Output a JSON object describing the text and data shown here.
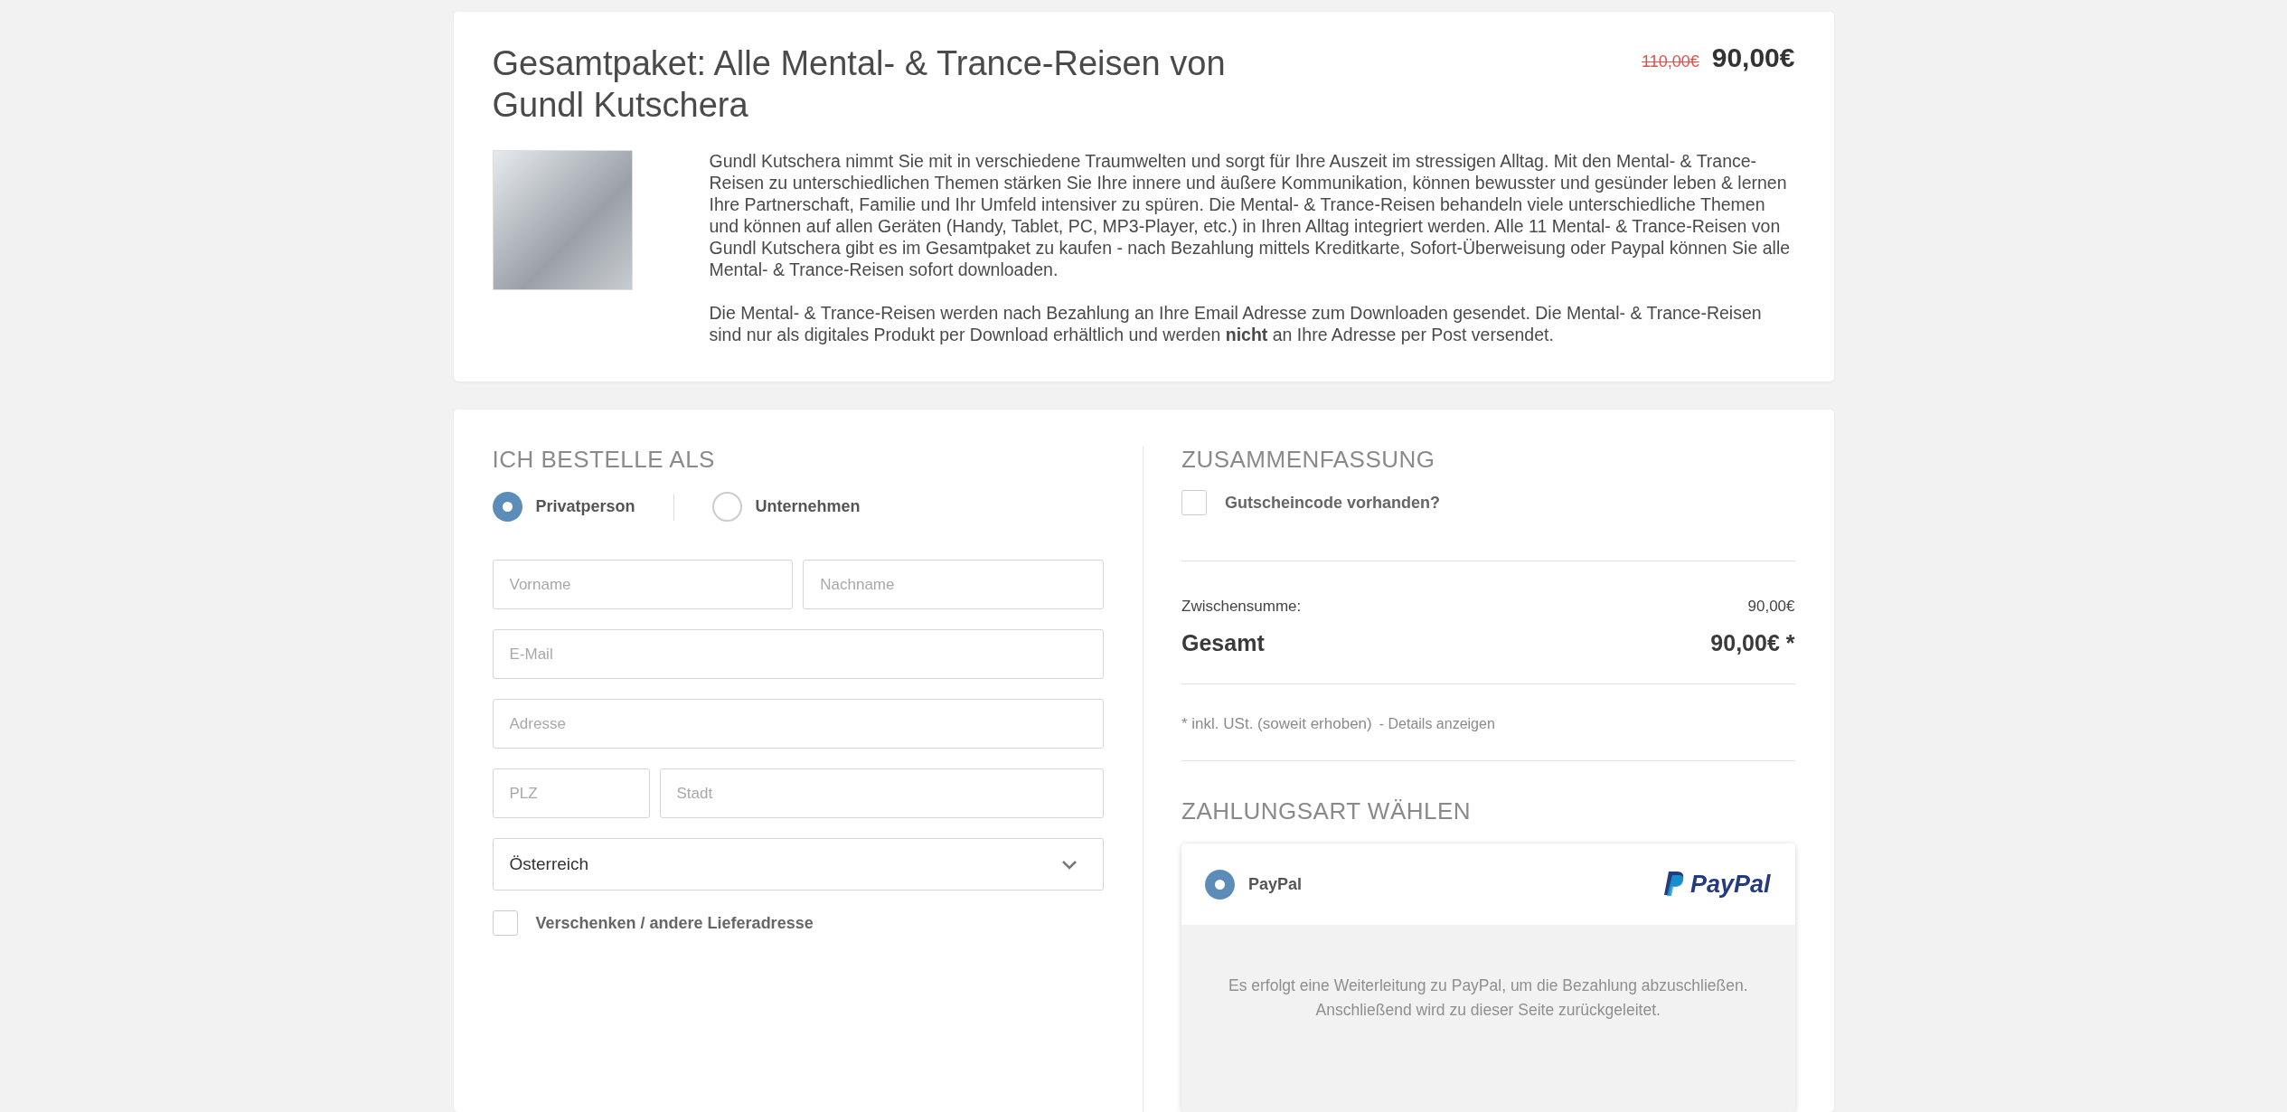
{
  "product": {
    "title": "Gesamtpaket: Alle Mental- & Trance-Reisen von Gundl Kutschera",
    "old_price": "110,00€",
    "price": "90,00€",
    "description": [
      "Gundl Kutschera nimmt Sie mit in verschiedene Traumwelten und sorgt für Ihre Auszeit im stressigen Alltag. Mit den Mental- & Trance-Reisen zu unterschiedlichen Themen stärken Sie Ihre innere und äußere Kommunikation, können bewusster und gesünder leben & lernen Ihre Partnerschaft, Familie und Ihr Umfeld intensiver zu spüren. Die Mental- & Trance-Reisen behandeln viele unterschiedliche Themen und können auf allen Geräten (Handy, Tablet, PC, MP3-Player, etc.) in Ihren Alltag integriert werden. Alle 11 Mental- & Trance-Reisen von Gundl Kutschera gibt es im Gesamtpaket zu kaufen - nach Bezahlung mittels Kreditkarte, Sofort-Überweisung oder Paypal können Sie alle Mental- & Trance-Reisen sofort downloaden.",
      "Die Mental- & Trance-Reisen werden nach Bezahlung an Ihre Email Adresse zum Downloaden gesendet. Die Mental- & Trance-Reisen sind nur als digitales Produkt per Download erhältlich und werden **nicht** an Ihre Adresse per Post versendet."
    ]
  },
  "order_as": {
    "heading": "ICH BESTELLE ALS",
    "options": [
      {
        "label": "Privatperson",
        "selected": true
      },
      {
        "label": "Unternehmen",
        "selected": false
      }
    ]
  },
  "address_form": {
    "rows": [
      [
        {
          "placeholder": "Vorname",
          "kind": "wide"
        },
        {
          "placeholder": "Nachname",
          "kind": "wide"
        }
      ],
      [
        {
          "placeholder": "E-Mail",
          "kind": "wide"
        }
      ],
      [
        {
          "placeholder": "Adresse",
          "kind": "wide"
        }
      ],
      [
        {
          "placeholder": "PLZ",
          "kind": "short"
        },
        {
          "placeholder": "Stadt",
          "kind": "wide"
        }
      ]
    ],
    "country": {
      "value": "Österreich"
    },
    "gift_option": {
      "label": "Verschenken / andere Lieferadresse",
      "checked": false
    }
  },
  "summary": {
    "heading": "ZUSAMMENFASSUNG",
    "voucher": {
      "label": "Gutscheincode vorhanden?",
      "checked": false
    },
    "subtotal": {
      "label": "Zwischensumme:",
      "value": "90,00€"
    },
    "total": {
      "label": "Gesamt",
      "value": "90,00€ *"
    },
    "tax_note": "* inkl. USt. (soweit erhoben)",
    "details_link": "- Details anzeigen"
  },
  "payment": {
    "heading": "ZAHLUNGSART WÄHLEN",
    "methods": [
      {
        "label": "PayPal",
        "selected": true,
        "logo": "PayPal",
        "info": "Es erfolgt eine Weiterleitung zu PayPal, um die Bezahlung abzuschließen. Anschließend wird zu dieser Seite zurückgeleitet."
      }
    ]
  }
}
